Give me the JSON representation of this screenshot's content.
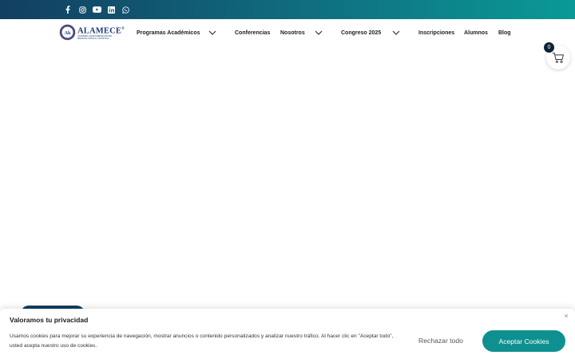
{
  "topbar": {
    "social": [
      {
        "icon": "facebook-icon"
      },
      {
        "icon": "instagram-icon"
      },
      {
        "icon": "youtube-icon"
      },
      {
        "icon": "linkedin-icon"
      },
      {
        "icon": "whatsapp-icon"
      }
    ],
    "gradient": [
      "#123f61",
      "#0f6f80",
      "#0a9a95"
    ]
  },
  "header": {
    "logo": {
      "name": "ALAMECE",
      "registered": "®",
      "tagline": "ACADEMIA LATINOAMERICANA DE MEDICINA CRÍTICA Y ESTÉTICA"
    },
    "nav": [
      {
        "label": "Programas Académicos",
        "dropdown": true
      },
      {
        "label": "Conferencias",
        "dropdown": false
      },
      {
        "label": "Nosotros",
        "dropdown": true
      },
      {
        "label": "Congreso 2025",
        "dropdown": true
      },
      {
        "label": "Inscripciones",
        "dropdown": false
      },
      {
        "label": "Alumnos",
        "dropdown": false
      },
      {
        "label": "Blog",
        "dropdown": false
      }
    ]
  },
  "cart": {
    "count": "0",
    "icon": "cart-icon"
  },
  "cookie_banner": {
    "title": "Valoramos tu privacidad",
    "text": "Usamos cookies para mejorar su experiencia de navegación, mostrar anuncios o contenido personalizados y analizar nuestro tráfico. Al hacer clic en \"Aceptar todo\", usted acepta nuestro uso de cookies.",
    "close": "×",
    "reject_label": "Rechazar todo",
    "accept_label": "Aceptar Cookies",
    "accent": "#0f9090"
  }
}
